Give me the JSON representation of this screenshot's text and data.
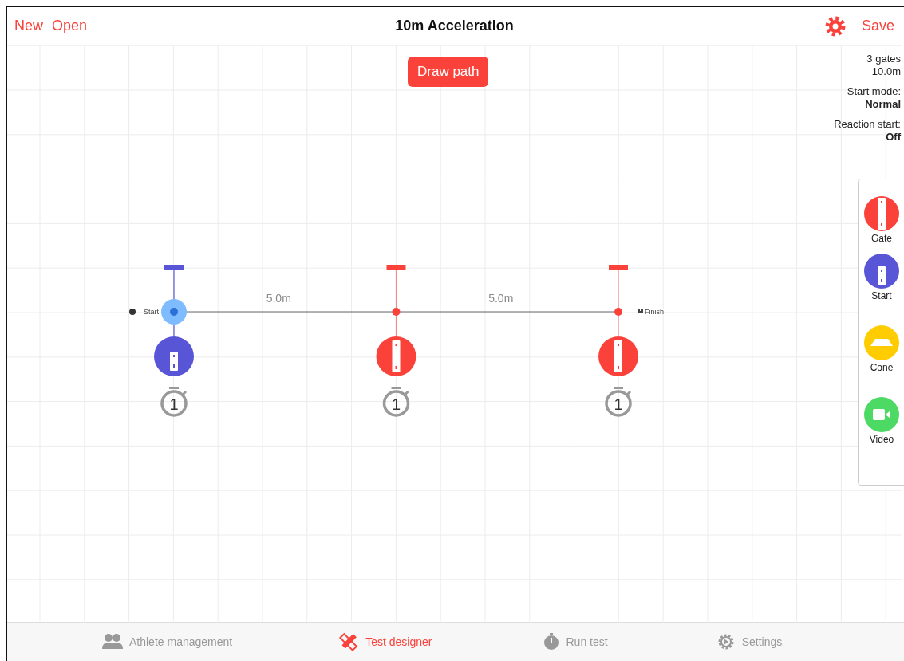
{
  "header": {
    "actions": [
      "New",
      "Open"
    ],
    "title": "10m Acceleration",
    "save": "Save"
  },
  "draw_path": "Draw path",
  "summary": {
    "gates": "3 gates",
    "distance": "10.0m",
    "start_mode_label": "Start mode:",
    "start_mode": "Normal",
    "reaction_label": "Reaction start:",
    "reaction": "Off"
  },
  "course": {
    "start_label": "Start",
    "finish_label": "Finish",
    "segments": [
      "5.0m",
      "5.0m"
    ],
    "nodes": [
      {
        "kind": "start",
        "selected": true,
        "timer": "1"
      },
      {
        "kind": "gate",
        "selected": false,
        "timer": "1"
      },
      {
        "kind": "gate",
        "selected": false,
        "timer": "1"
      }
    ]
  },
  "palette": [
    {
      "kind": "gate",
      "label": "Gate"
    },
    {
      "kind": "start",
      "label": "Start"
    },
    {
      "kind": "cone",
      "label": "Cone"
    },
    {
      "kind": "video",
      "label": "Video"
    }
  ],
  "tabs": [
    {
      "kind": "athletes",
      "label": "Athlete management",
      "selected": false
    },
    {
      "kind": "designer",
      "label": "Test designer",
      "selected": true
    },
    {
      "kind": "run",
      "label": "Run test",
      "selected": false
    },
    {
      "kind": "settings",
      "label": "Settings",
      "selected": false
    }
  ]
}
